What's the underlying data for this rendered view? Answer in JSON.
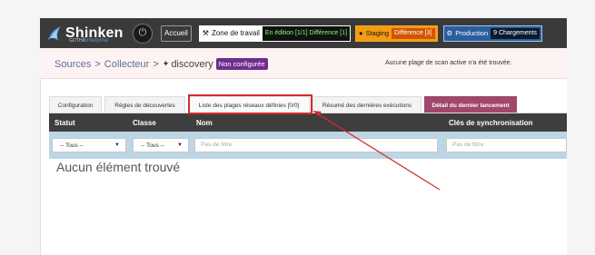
{
  "topbar": {
    "logo_text": "Shinken",
    "logo_sub": "GOTHA",
    "logo_edition": "Enterprise",
    "home_label": "Accueil",
    "workspace_label": "Zone de travail",
    "workspace_status": "En édition [1/1] Différence [1]",
    "staging_label": "Staging",
    "staging_status": "Différence [3]",
    "production_label": "Production",
    "production_status": "9 Chargements"
  },
  "breadcrumb": {
    "sources": "Sources",
    "collector": "Collecteur",
    "discovery": "discovery",
    "badge": "Non configurée",
    "message": "Aucune plage de scan active n'a été trouvée."
  },
  "tabs": [
    {
      "label": "Configuration"
    },
    {
      "label": "Règles de découvertes"
    },
    {
      "label": "Liste des plages réseaux définies [0/0]"
    },
    {
      "label": "Résumé des dernières exécutions"
    },
    {
      "label": "Détail du dernier lancement"
    }
  ],
  "table": {
    "columns": [
      "Statut",
      "Classe",
      "Nom",
      "Clés de synchronisation"
    ],
    "filter_status": "-- Tous --",
    "filter_class": "-- Tous --",
    "filter_name_placeholder": "Pas de filtre",
    "filter_keys_placeholder": "Pas de filtre",
    "empty_message": "Aucun élément trouvé"
  },
  "colors": {
    "topbar": "#3a3a3a",
    "active_tab": "#a1476b",
    "badge": "#6f2d8e",
    "annotation": "#d12c2c",
    "filter_row": "#bcd6e6"
  }
}
